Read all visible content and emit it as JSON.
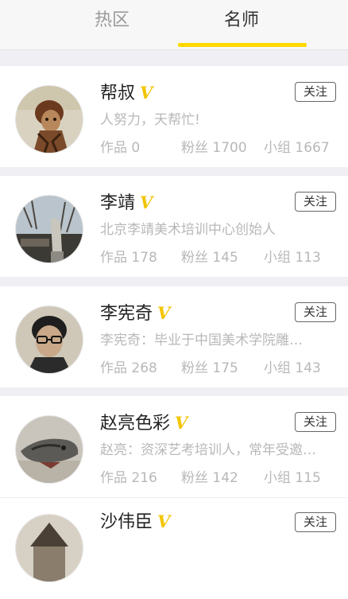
{
  "tabs": [
    {
      "label": "热区",
      "active": false
    },
    {
      "label": "名师",
      "active": true
    }
  ],
  "accent_color": "#ffd800",
  "verified_badge": "V",
  "follow_label": "关注",
  "teachers": [
    {
      "name": "帮叔",
      "bio": "人努力，天帮忙!",
      "works": "作品 0",
      "fans": "粉丝 1700",
      "groups": "小组 1667"
    },
    {
      "name": "李靖",
      "bio": "北京李靖美术培训中心创始人",
      "works": "作品 178",
      "fans": "粉丝 145",
      "groups": "小组 113"
    },
    {
      "name": "李宪奇",
      "bio": "李宪奇：毕业于中国美术学院雕…",
      "works": "作品 268",
      "fans": "粉丝 175",
      "groups": "小组 143"
    },
    {
      "name": "赵亮色彩",
      "bio": "赵亮：资深艺考培训人，常年受邀…",
      "works": "作品 216",
      "fans": "粉丝 142",
      "groups": "小组 115"
    },
    {
      "name": "沙伟臣",
      "bio": "",
      "works": "",
      "fans": "",
      "groups": ""
    }
  ]
}
